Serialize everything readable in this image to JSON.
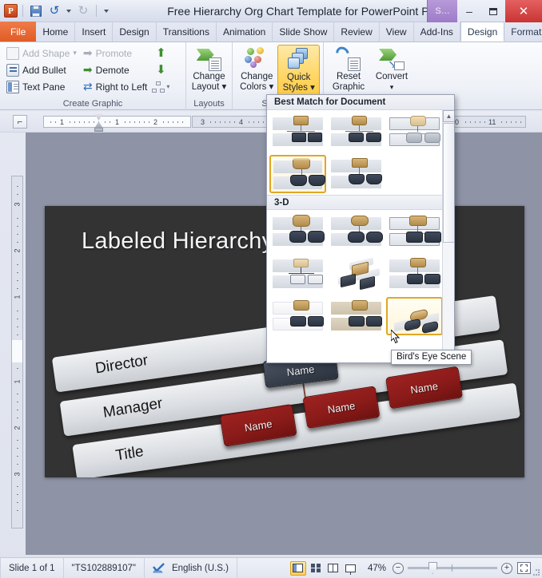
{
  "window": {
    "title": "Free Hierarchy Org Chart Template for PowerPoint Prese…",
    "app_logo": "powerpoint-logo",
    "contextual_group": "S…",
    "minimize": "–",
    "maximize": "❐",
    "close": "✕"
  },
  "quick_access": {
    "save": "save-icon",
    "undo": "↺",
    "undo_caret": "▾",
    "redo": "↻",
    "customize": "▾"
  },
  "tabs": [
    {
      "label": "File",
      "kind": "file"
    },
    {
      "label": "Home",
      "kind": "normal"
    },
    {
      "label": "Insert",
      "kind": "normal"
    },
    {
      "label": "Design",
      "kind": "normal"
    },
    {
      "label": "Transitions",
      "kind": "normal"
    },
    {
      "label": "Animation",
      "kind": "normal"
    },
    {
      "label": "Slide Show",
      "kind": "normal"
    },
    {
      "label": "Review",
      "kind": "normal"
    },
    {
      "label": "View",
      "kind": "normal"
    },
    {
      "label": "Add-Ins",
      "kind": "normal"
    },
    {
      "label": "Design",
      "kind": "contextual-active"
    },
    {
      "label": "Format",
      "kind": "contextual"
    }
  ],
  "tab_extras": {
    "minimize_ribbon": "⌂",
    "help": "?"
  },
  "ribbon": {
    "create_graphic": {
      "title": "Create Graphic",
      "add_shape": "Add Shape",
      "add_shape_caret": "▾",
      "add_bullet": "Add Bullet",
      "text_pane": "Text Pane",
      "promote": "Promote",
      "demote": "Demote",
      "right_to_left": "Right to Left",
      "move_up": "⬆",
      "move_down": "⬇",
      "layout_caret": "▾"
    },
    "layouts": {
      "title": "Layouts",
      "change_layout_line1": "Change",
      "change_layout_line2": "Layout ▾"
    },
    "smartart_styles": {
      "title": "SmartAr",
      "change_colors_line1": "Change",
      "change_colors_line2": "Colors ▾",
      "quick_styles_line1": "Quick",
      "quick_styles_line2": "Styles ▾"
    },
    "reset": {
      "reset_graphic_line1": "Reset",
      "reset_graphic_line2": "Graphic",
      "convert_line1": "Convert",
      "convert_line2": "▾"
    }
  },
  "ruler": {
    "horizontal_labels": [
      "1",
      "1",
      "2",
      "3",
      "4",
      "0",
      "11"
    ],
    "vertical_labels": [
      "3",
      "2",
      "1",
      "1",
      "2",
      "3"
    ],
    "corner_button": "⌐"
  },
  "slide": {
    "title": "Labeled Hierarchy",
    "levels": [
      "Director",
      "Manager",
      "Title"
    ],
    "nodes": [
      {
        "label": "Name",
        "color": "dark"
      },
      {
        "label": "Name",
        "color": "red"
      },
      {
        "label": "Name",
        "color": "red"
      },
      {
        "label": "Name",
        "color": "red"
      }
    ]
  },
  "gallery": {
    "header": "Best Match for Document",
    "section_3d": "3-D",
    "scroll_up": "▲",
    "scroll_down": "▼",
    "tooltip": "Bird's Eye Scene",
    "best_match_rows": [
      [
        "style-thumb-1",
        "style-thumb-2",
        "style-thumb-3"
      ],
      [
        "style-thumb-4-selected",
        "style-thumb-5"
      ]
    ],
    "threed_rows": [
      [
        "style-3d-1",
        "style-3d-2",
        "style-3d-3"
      ],
      [
        "style-3d-4",
        "style-3d-5",
        "style-3d-6"
      ],
      [
        "style-3d-7",
        "style-3d-8",
        "style-3d-9-birds-eye-scene"
      ]
    ]
  },
  "status_bar": {
    "slide_counter": "Slide 1 of 1",
    "theme_name": "\"TS102889107\"",
    "spell_check": "spell-check-icon",
    "language": "English (U.S.)",
    "view_normal": "normal-view-icon",
    "view_sorter": "slide-sorter-icon",
    "view_reading": "reading-view-icon",
    "view_slideshow": "slide-show-icon",
    "zoom_level": "47%",
    "zoom_out": "−",
    "zoom_in": "+",
    "fit_to_window": "fit-slide-icon"
  }
}
